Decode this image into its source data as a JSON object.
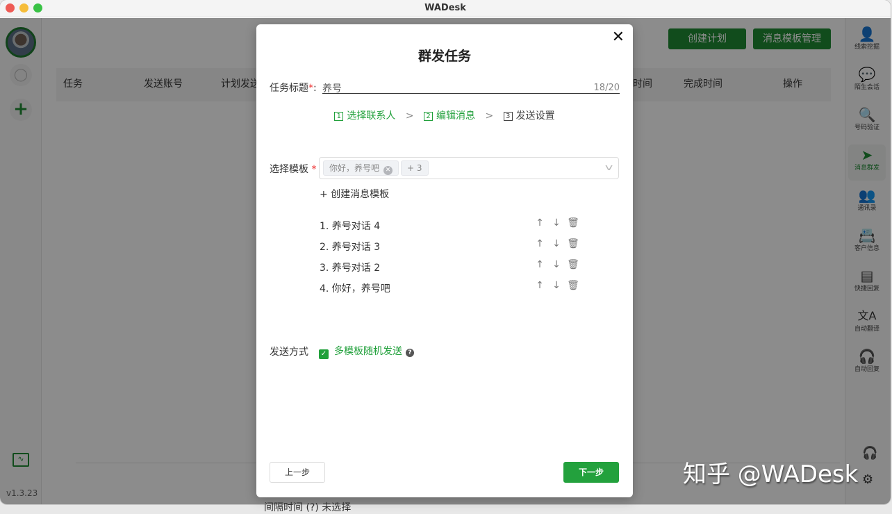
{
  "window": {
    "title": "WADesk"
  },
  "left_sidebar": {
    "version": "v1.3.23",
    "icons": [
      "avatar",
      "user-icon",
      "add-icon",
      "monitor-chart-icon"
    ]
  },
  "main": {
    "buttons": {
      "create_plan": "创建计划",
      "template_manage": "消息模板管理"
    },
    "table_headers": [
      "任务",
      "发送账号",
      "计划发送时间",
      "时间",
      "完成时间",
      "操作"
    ],
    "bottom_strip": "间隔时间 (?)   未选择"
  },
  "right_sidebar": {
    "items": [
      {
        "label": "线索挖掘",
        "icon": "lead-mining-icon",
        "glyph": "👤"
      },
      {
        "label": "陌生会话",
        "icon": "stranger-chat-icon",
        "glyph": "💬"
      },
      {
        "label": "号码验证",
        "icon": "number-verify-icon",
        "glyph": "🔍"
      },
      {
        "label": "消息群发",
        "icon": "send-plane-icon",
        "glyph": "➤",
        "active": true
      },
      {
        "label": "通讯录",
        "icon": "contacts-icon",
        "glyph": "👥"
      },
      {
        "label": "客户信息",
        "icon": "customer-info-icon",
        "glyph": "📇"
      },
      {
        "label": "快捷回复",
        "icon": "quick-reply-icon",
        "glyph": "▤"
      },
      {
        "label": "自动翻译",
        "icon": "translate-icon",
        "glyph": "文A"
      },
      {
        "label": "自动回复",
        "icon": "auto-reply-icon",
        "glyph": "🎧"
      }
    ],
    "bottom_icons": {
      "headset": "🎧",
      "settings": "⚙"
    }
  },
  "modal": {
    "title": "群发任务",
    "close": "✕",
    "task_title_label": "任务标题",
    "task_title_required": "*",
    "task_title_colon": ":",
    "task_title_value": "养号",
    "task_title_count": "18/20",
    "steps": [
      {
        "num": "1",
        "label": "选择联系人",
        "state": "done"
      },
      {
        "num": "2",
        "label": "编辑消息",
        "state": "done"
      },
      {
        "num": "3",
        "label": "发送设置",
        "state": "current"
      }
    ],
    "step_separator": ">",
    "template_label": "选择模板",
    "template_required": "*",
    "selected_tag": "你好，养号吧",
    "more_tag": "+ 3",
    "create_template": "+ 创建消息模板",
    "template_list": [
      "1. 养号对话 4",
      "2. 养号对话 3",
      "3. 养号对话 2",
      "4. 你好，养号吧"
    ],
    "row_actions": {
      "up": "↑",
      "down": "↓",
      "delete": "🗑"
    },
    "send_mode_label": "发送方式",
    "send_mode_option": "多模板随机发送",
    "send_mode_checked": true,
    "help": "?",
    "prev_button": "上一步",
    "next_button": "下一步"
  },
  "watermark": "知乎 @WADesk",
  "colors": {
    "brand_green": "#1f8b34",
    "step_green": "#21a03b",
    "next_button": "#23a13d"
  }
}
